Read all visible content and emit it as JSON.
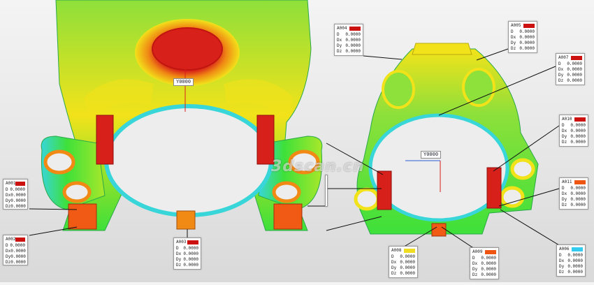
{
  "watermark": "3dscan.cn",
  "colors": {
    "red": "#d8201a",
    "orange": "#f05a14",
    "yellow": "#f2e21a",
    "green": "#3ee03a",
    "cyan": "#38d6d8",
    "deviation_swatch_red": "#cc1111",
    "deviation_swatch_orange": "#ee5511",
    "deviation_swatch_yellow": "#eedd22",
    "deviation_swatch_cyan": "#33ccee"
  },
  "views": {
    "left": {
      "axis_label": "Y0000"
    },
    "right": {
      "axis_label": "Y0000"
    }
  },
  "callouts": [
    {
      "id": "c1",
      "header": "A001",
      "swatch": "deviation_swatch_red",
      "rows": [
        [
          "D",
          "0.0000"
        ],
        [
          "Dx",
          "0.0000"
        ],
        [
          "Dy",
          "0.0000"
        ],
        [
          "Dz",
          "0.0000"
        ]
      ]
    },
    {
      "id": "c2",
      "header": "A002",
      "swatch": "deviation_swatch_red",
      "rows": [
        [
          "D",
          "0.0000"
        ],
        [
          "Dx",
          "0.0000"
        ],
        [
          "Dy",
          "0.0000"
        ],
        [
          "Dz",
          "0.0000"
        ]
      ]
    },
    {
      "id": "c3",
      "header": "A003",
      "swatch": "deviation_swatch_red",
      "rows": [
        [
          "D",
          "0.0000"
        ],
        [
          "Dx",
          "0.0000"
        ],
        [
          "Dy",
          "0.0000"
        ],
        [
          "Dz",
          "0.0000"
        ]
      ]
    },
    {
      "id": "c4",
      "header": "A004",
      "swatch": "deviation_swatch_red",
      "rows": [
        [
          "D",
          "0.0000"
        ],
        [
          "Dx",
          "0.0000"
        ],
        [
          "Dy",
          "0.0000"
        ],
        [
          "Dz",
          "0.0000"
        ]
      ]
    },
    {
      "id": "c5",
      "header": "A005",
      "swatch": "deviation_swatch_red",
      "rows": [
        [
          "D",
          "0.0000"
        ],
        [
          "Dx",
          "0.0000"
        ],
        [
          "Dy",
          "0.0000"
        ],
        [
          "Dz",
          "0.0000"
        ]
      ]
    },
    {
      "id": "c6",
      "header": "A006",
      "swatch": "deviation_swatch_cyan",
      "rows": [
        [
          "D",
          "0.0000"
        ],
        [
          "Dx",
          "0.0000"
        ],
        [
          "Dy",
          "0.0000"
        ],
        [
          "Dz",
          "0.0000"
        ]
      ]
    },
    {
      "id": "c7",
      "header": "A007",
      "swatch": "deviation_swatch_red",
      "rows": [
        [
          "D",
          "0.0000"
        ],
        [
          "Dx",
          "0.0000"
        ],
        [
          "Dy",
          "0.0000"
        ],
        [
          "Dz",
          "0.0000"
        ]
      ]
    },
    {
      "id": "c8",
      "header": "A008",
      "swatch": "deviation_swatch_yellow",
      "rows": [
        [
          "D",
          "0.0000"
        ],
        [
          "Dx",
          "0.0000"
        ],
        [
          "Dy",
          "0.0000"
        ],
        [
          "Dz",
          "0.0000"
        ]
      ]
    },
    {
      "id": "c9",
      "header": "A009",
      "swatch": "deviation_swatch_orange",
      "rows": [
        [
          "D",
          "0.0000"
        ],
        [
          "Dx",
          "0.0000"
        ],
        [
          "Dy",
          "0.0000"
        ],
        [
          "Dz",
          "0.0000"
        ]
      ]
    },
    {
      "id": "c10",
      "header": "A010",
      "swatch": "deviation_swatch_red",
      "rows": [
        [
          "D",
          "0.0000"
        ],
        [
          "Dx",
          "0.0000"
        ],
        [
          "Dy",
          "0.0000"
        ],
        [
          "Dz",
          "0.0000"
        ]
      ]
    },
    {
      "id": "c11",
      "header": "A011",
      "swatch": "deviation_swatch_orange",
      "rows": [
        [
          "D",
          "0.0000"
        ],
        [
          "Dx",
          "0.0000"
        ],
        [
          "Dy",
          "0.0000"
        ],
        [
          "Dz",
          "0.0000"
        ]
      ]
    },
    {
      "id": "c12",
      "header": "A012",
      "swatch": "deviation_swatch_orange",
      "rows": [
        [
          "D",
          "0.0000"
        ],
        [
          "Dx",
          "0.0000"
        ],
        [
          "Dy",
          "0.0000"
        ],
        [
          "Dz",
          "0.0000"
        ]
      ]
    }
  ]
}
